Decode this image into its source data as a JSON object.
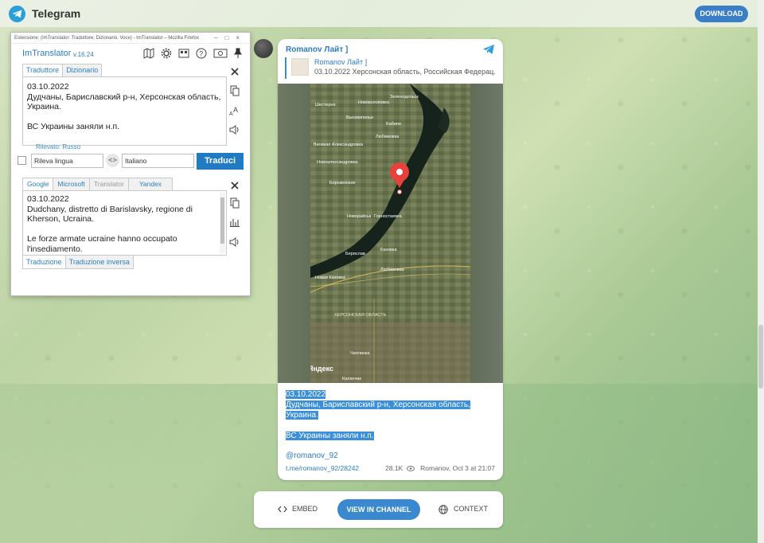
{
  "telegram": {
    "app_title": "Telegram",
    "download_label": "DOWNLOAD"
  },
  "post": {
    "author": "Romanov Лайт ]",
    "reply": {
      "name": "Romanov Лайт ]",
      "text": "03.10.2022 Херсонская область, Российская Федерац..."
    },
    "message_lines": [
      "03.10.2022",
      "Дудчаны, Бариславский р-н, Херсонская область,",
      "Украина.",
      "",
      "ВС Украины заняли н.п."
    ],
    "signature": "@romanov_92",
    "url": "t.me/romanov_92/28242",
    "views": "28.1K",
    "meta": "Romanov, Oct 3 at 21:07"
  },
  "map": {
    "labels": [
      "Шестерня",
      "Зеленодольск",
      "Новоколоховка",
      "Высокополье",
      "Бабино",
      "Любимовка",
      "Великая Александровка",
      "Новоалександровка",
      "Борозенское",
      "Новорайськ",
      "Горностаевка",
      "Берислав",
      "Каховка",
      "Любимовка",
      "Новая Каховка",
      "ХЕРСОНСКАЯ ОБЛАСТЬ",
      "Чаплинка",
      "Каланчак",
      "Яндекс"
    ]
  },
  "actions": {
    "embed": "EMBED",
    "view_in_channel": "VIEW IN CHANNEL",
    "context": "CONTEXT"
  },
  "imtranslator": {
    "window_title": "Estensione: (ImTranslator: Traduttore, Dizionario, Voce) - ImTranslator – Mozilla Firefox",
    "brand": "ImTranslator",
    "version": "v.16.24",
    "tabs": [
      "Traduttore",
      "Dizionario"
    ],
    "source_lines": [
      "03.10.2022",
      "Дудчаны, Бариславский р-н, Херсонская область,",
      "Украина.",
      "",
      "ВС Украины заняли н.п."
    ],
    "detected": "Rilevato: Russo",
    "source_lang": "Rileva lingua",
    "target_lang": "Italiano",
    "translate_button": "Traduci",
    "services": [
      "Google",
      "Microsoft",
      "Translator",
      "Yandex"
    ],
    "target_lines": [
      "03.10.2022",
      "Dudchany, distretto di Barislavsky, regione di",
      "Kherson, Ucraina.",
      "",
      "Le forze armate ucraine hanno occupato",
      "l'insediamento."
    ],
    "bottom_tabs": [
      "Traduzione",
      "Traduzione inversa"
    ]
  },
  "colors": {
    "accent": "#3a88cf",
    "link": "#2c7cbf",
    "highlight": "#3a8fd8",
    "map_pin": "#e8403a"
  }
}
